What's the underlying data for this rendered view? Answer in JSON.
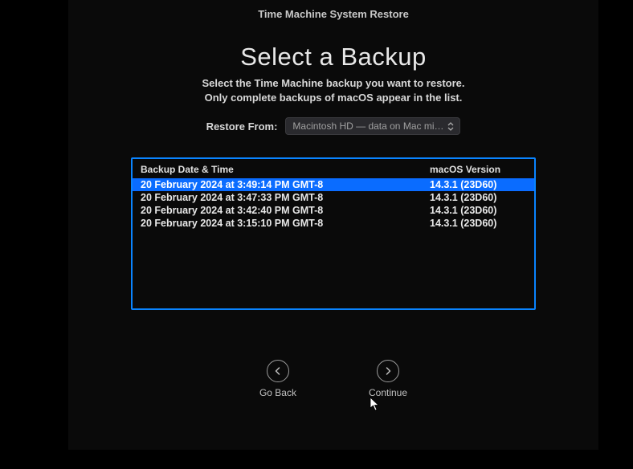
{
  "titlebar": "Time Machine System Restore",
  "heading": "Select a Backup",
  "subtext_line1": "Select the Time Machine backup you want to restore.",
  "subtext_line2": "Only complete backups of macOS appear in the list.",
  "restore_label": "Restore From:",
  "restore_selected": "Macintosh HD — data on Mac mini -…",
  "columns": {
    "date": "Backup Date & Time",
    "version": "macOS Version"
  },
  "backups": [
    {
      "date": "20 February 2024 at 3:49:14 PM GMT-8",
      "version": "14.3.1 (23D60)",
      "selected": true
    },
    {
      "date": "20 February 2024 at 3:47:33 PM GMT-8",
      "version": "14.3.1 (23D60)",
      "selected": false
    },
    {
      "date": "20 February 2024 at 3:42:40 PM GMT-8",
      "version": "14.3.1 (23D60)",
      "selected": false
    },
    {
      "date": "20 February 2024 at 3:15:10 PM GMT-8",
      "version": "14.3.1 (23D60)",
      "selected": false
    }
  ],
  "buttons": {
    "back": "Go Back",
    "continue": "Continue"
  }
}
